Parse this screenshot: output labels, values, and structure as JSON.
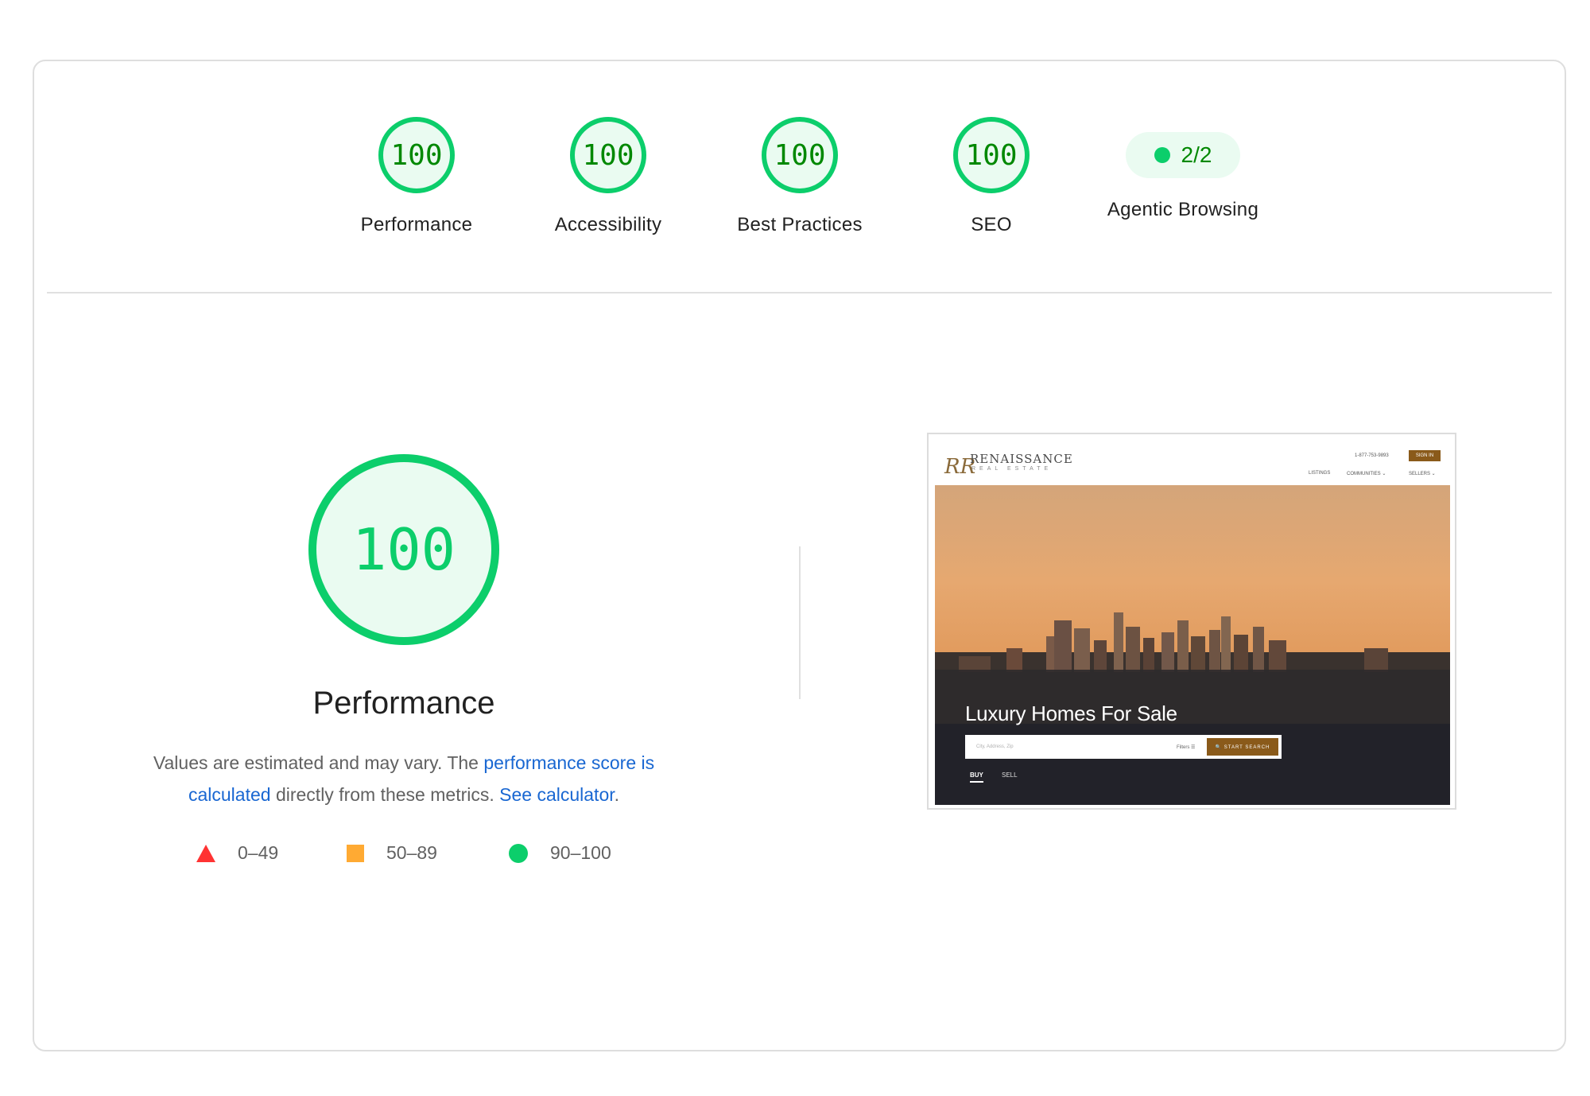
{
  "categories": [
    {
      "label": "Performance",
      "score": "100"
    },
    {
      "label": "Accessibility",
      "score": "100"
    },
    {
      "label": "Best Practices",
      "score": "100"
    },
    {
      "label": "SEO",
      "score": "100"
    }
  ],
  "agentic": {
    "label": "Agentic Browsing",
    "value": "2/2"
  },
  "main": {
    "score": "100",
    "title": "Performance",
    "desc_part1": "Values are estimated and may vary. The ",
    "desc_link1": "performance score is calculated",
    "desc_part2": " directly from these metrics. ",
    "desc_link2": "See calculator",
    "desc_part3": "."
  },
  "legend": [
    {
      "label": "0–49",
      "icon": "red-triangle-icon"
    },
    {
      "label": "50–89",
      "icon": "orange-square-icon"
    },
    {
      "label": "90–100",
      "icon": "green-circle-icon"
    }
  ],
  "colors": {
    "pass": "#0cce6b",
    "pass_text": "#008800",
    "average": "#ffaa33",
    "fail": "#ff3333",
    "link": "#1967d2"
  },
  "screenshot": {
    "logo_mark": "RR",
    "logo_name": "RENAISSANCE",
    "logo_sub": "REAL ESTATE",
    "phone": "1-877-753-9893",
    "signin": "SIGN IN",
    "nav": [
      "LISTINGS",
      "COMMUNITIES ⌄",
      "SELLERS ⌄"
    ],
    "hero_title": "Luxury Homes For Sale",
    "search_placeholder": "City, Address, Zip",
    "filters": "Filters ☰",
    "search_button": "🔍 START SEARCH",
    "tab_buy": "BUY",
    "tab_sell": "SELL"
  }
}
